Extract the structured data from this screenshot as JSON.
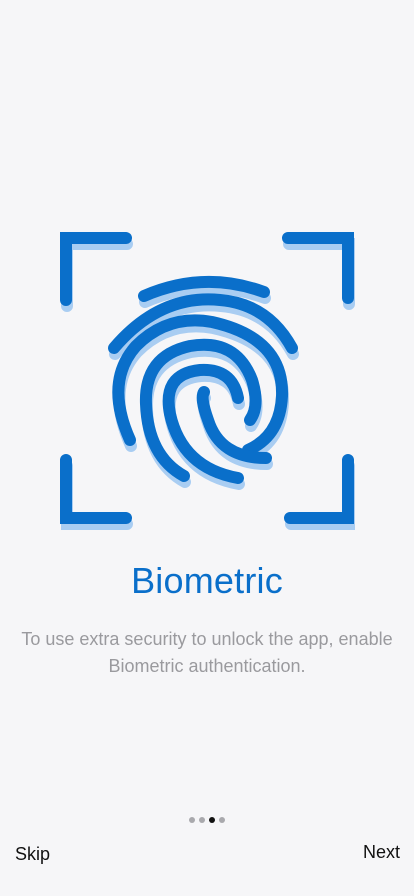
{
  "onboarding": {
    "title": "Biometric",
    "description": "To use extra security to unlock the app, enable Biometric authentication.",
    "illustration_icon": "fingerprint-scan-icon",
    "accent_color": "#0a6fca",
    "shadow_color": "#a9cdf2",
    "pager": {
      "total": 4,
      "current_index": 2
    },
    "skip_label": "Skip",
    "next_label": "Next"
  }
}
